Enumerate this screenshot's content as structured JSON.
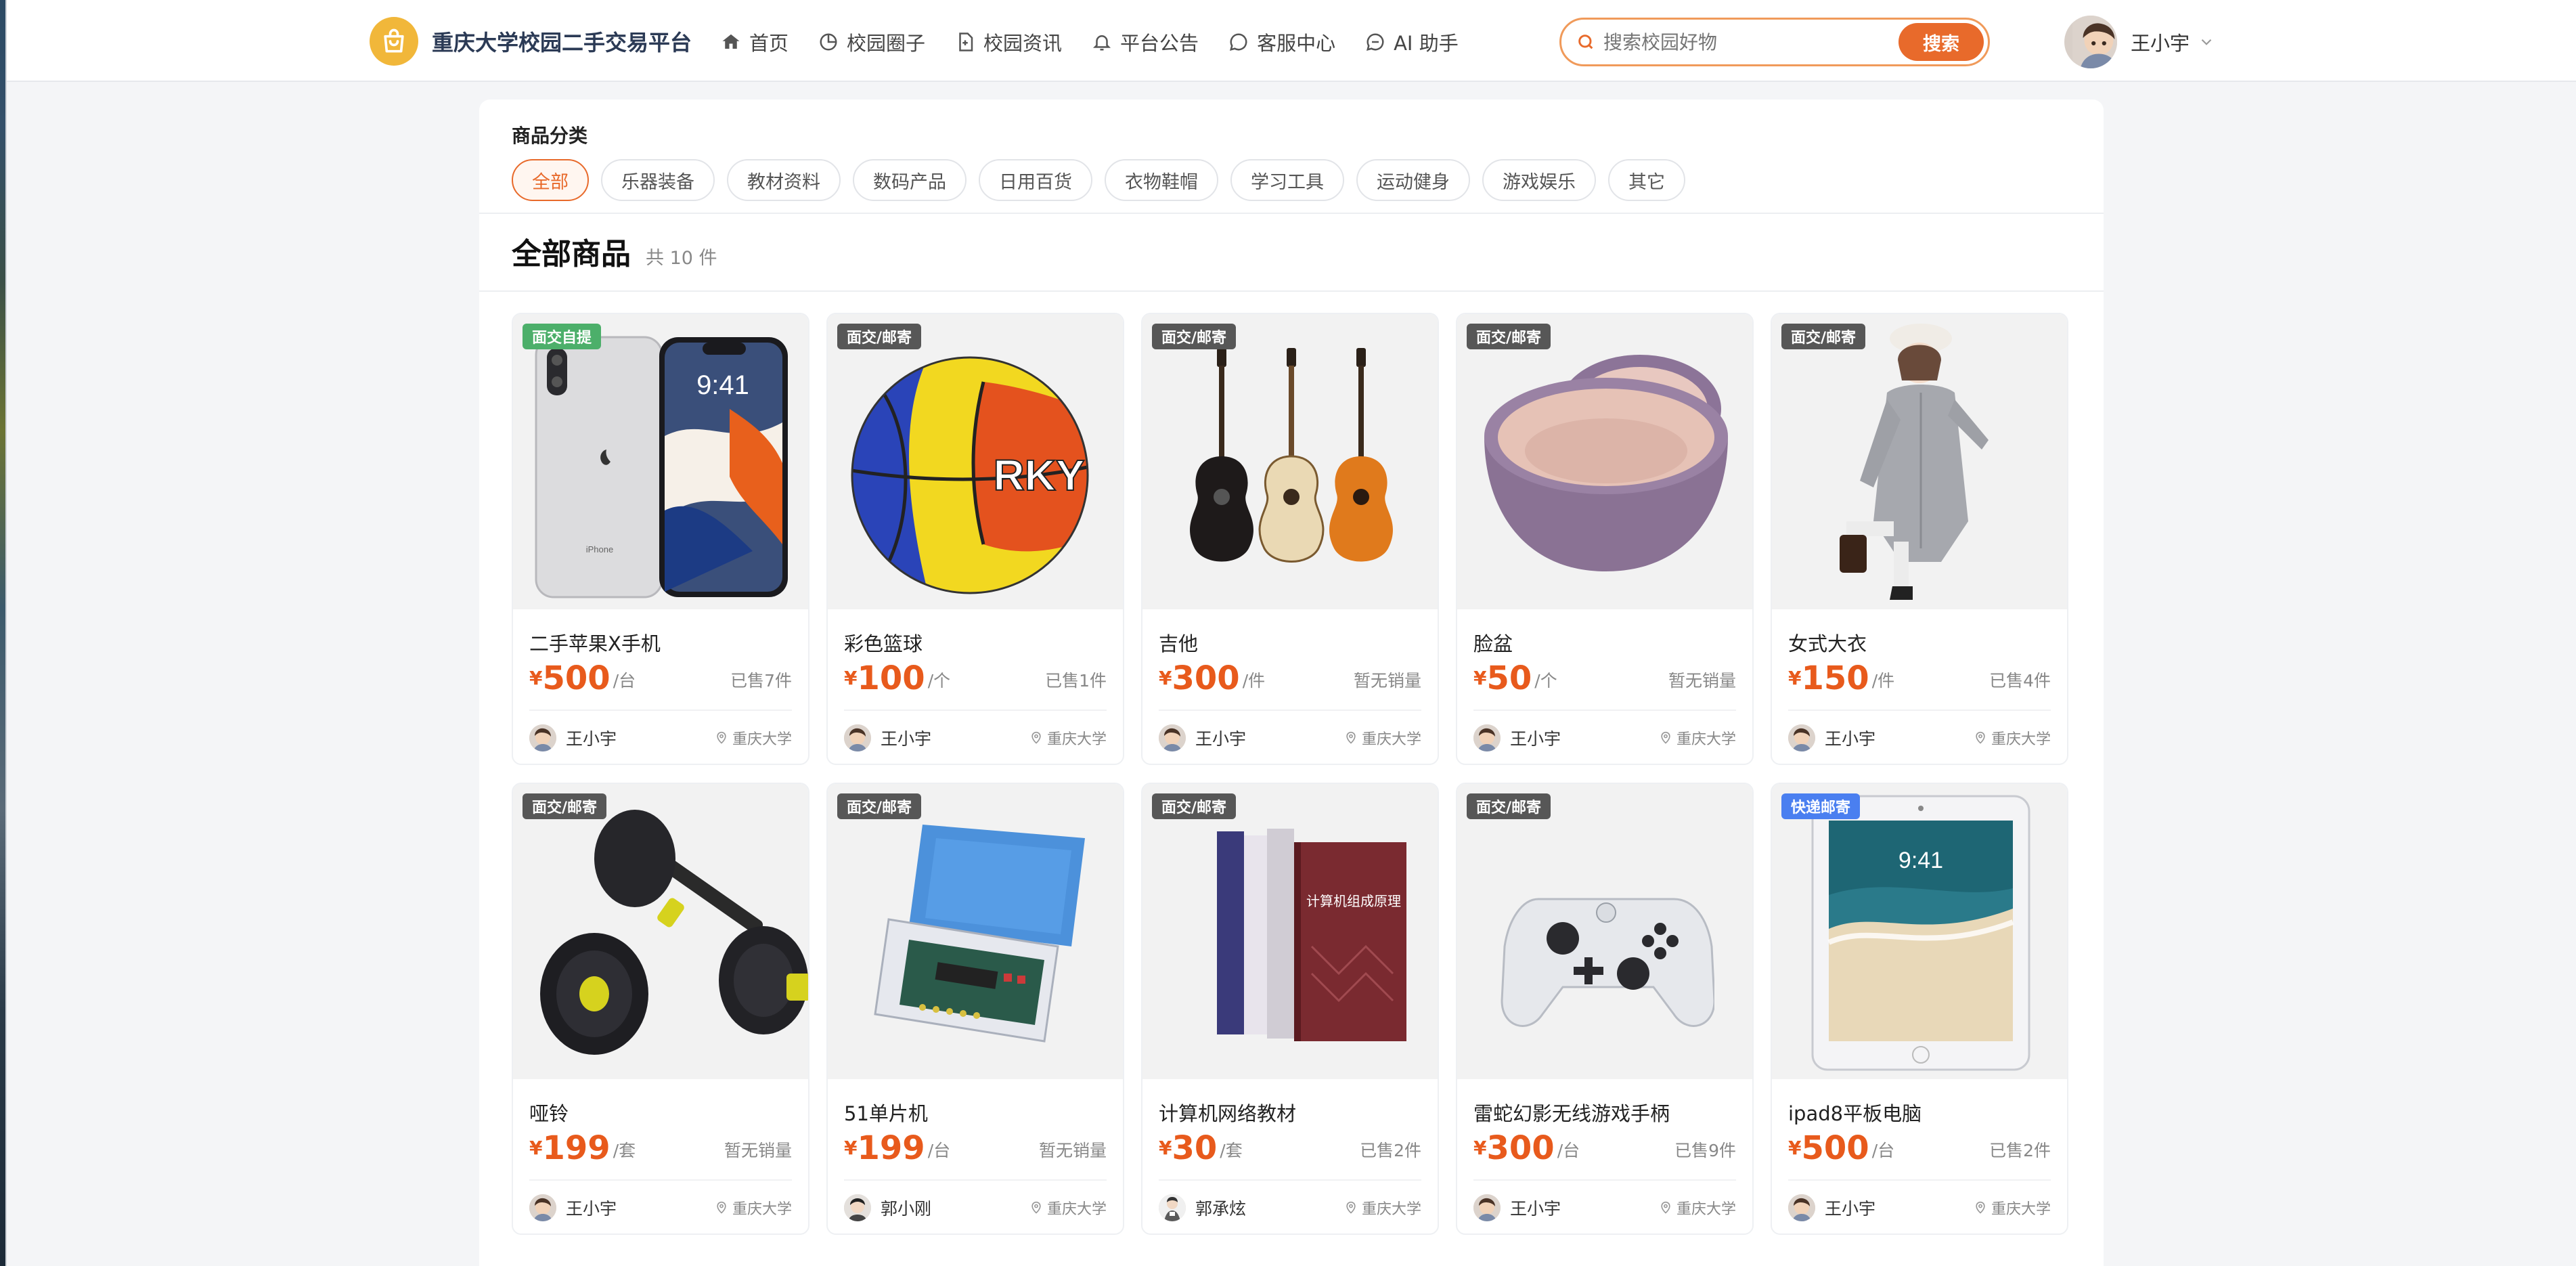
{
  "header": {
    "brand": "重庆大学校园二手交易平台",
    "nav": [
      {
        "label": "首页",
        "icon": "home-icon"
      },
      {
        "label": "校园圈子",
        "icon": "circle-icon"
      },
      {
        "label": "校园资讯",
        "icon": "news-icon"
      },
      {
        "label": "平台公告",
        "icon": "bell-icon"
      },
      {
        "label": "客服中心",
        "icon": "chat-icon"
      },
      {
        "label": "AI 助手",
        "icon": "chat-icon"
      }
    ],
    "search": {
      "placeholder": "搜索校园好物",
      "button": "搜索"
    },
    "user": {
      "name": "王小宇"
    }
  },
  "categories": {
    "title": "商品分类",
    "items": [
      "全部",
      "乐器装备",
      "教材资料",
      "数码产品",
      "日用百货",
      "衣物鞋帽",
      "学习工具",
      "运动健身",
      "游戏娱乐",
      "其它"
    ],
    "active": "全部"
  },
  "section": {
    "title": "全部商品",
    "count": "共 10 件"
  },
  "products": [
    {
      "name": "二手苹果X手机",
      "price": "500",
      "unit": "/台",
      "sold": "已售7件",
      "badge": "面交自提",
      "seller": "王小宇",
      "location": "重庆大学",
      "currency": "¥"
    },
    {
      "name": "彩色篮球",
      "price": "100",
      "unit": "/个",
      "sold": "已售1件",
      "badge": "面交/邮寄",
      "seller": "王小宇",
      "location": "重庆大学",
      "currency": "¥"
    },
    {
      "name": "吉他",
      "price": "300",
      "unit": "/件",
      "sold": "暂无销量",
      "badge": "面交/邮寄",
      "seller": "王小宇",
      "location": "重庆大学",
      "currency": "¥"
    },
    {
      "name": "脸盆",
      "price": "50",
      "unit": "/个",
      "sold": "暂无销量",
      "badge": "面交/邮寄",
      "seller": "王小宇",
      "location": "重庆大学",
      "currency": "¥"
    },
    {
      "name": "女式大衣",
      "price": "150",
      "unit": "/件",
      "sold": "已售4件",
      "badge": "面交/邮寄",
      "seller": "王小宇",
      "location": "重庆大学",
      "currency": "¥"
    },
    {
      "name": "哑铃",
      "price": "199",
      "unit": "/套",
      "sold": "暂无销量",
      "badge": "面交/邮寄",
      "seller": "王小宇",
      "location": "重庆大学",
      "currency": "¥"
    },
    {
      "name": "51单片机",
      "price": "199",
      "unit": "/台",
      "sold": "暂无销量",
      "badge": "面交/邮寄",
      "seller": "郭小刚",
      "location": "重庆大学",
      "currency": "¥"
    },
    {
      "name": "计算机网络教材",
      "price": "30",
      "unit": "/套",
      "sold": "已售2件",
      "badge": "面交/邮寄",
      "seller": "郭承炫",
      "location": "重庆大学",
      "currency": "¥"
    },
    {
      "name": "雷蛇幻影无线游戏手柄",
      "price": "300",
      "unit": "/台",
      "sold": "已售9件",
      "badge": "面交/邮寄",
      "seller": "王小宇",
      "location": "重庆大学",
      "currency": "¥"
    },
    {
      "name": "ipad8平板电脑",
      "price": "500",
      "unit": "/台",
      "sold": "已售2件",
      "badge": "快递邮寄",
      "seller": "王小宇",
      "location": "重庆大学",
      "currency": "¥"
    }
  ],
  "images": {
    "phone_time": "9:41",
    "phone_brand": "iPhone",
    "ball_text": "RKY",
    "book_text": "计算机组成原理",
    "ipad_time": "9:41"
  },
  "colors": {
    "accent": "#e86a2b",
    "brand": "#2b3a55",
    "logo": "#f1b73a",
    "badge_default": "#575757",
    "badge_green": "#4caf6a",
    "badge_blue": "#4a7ff0"
  }
}
